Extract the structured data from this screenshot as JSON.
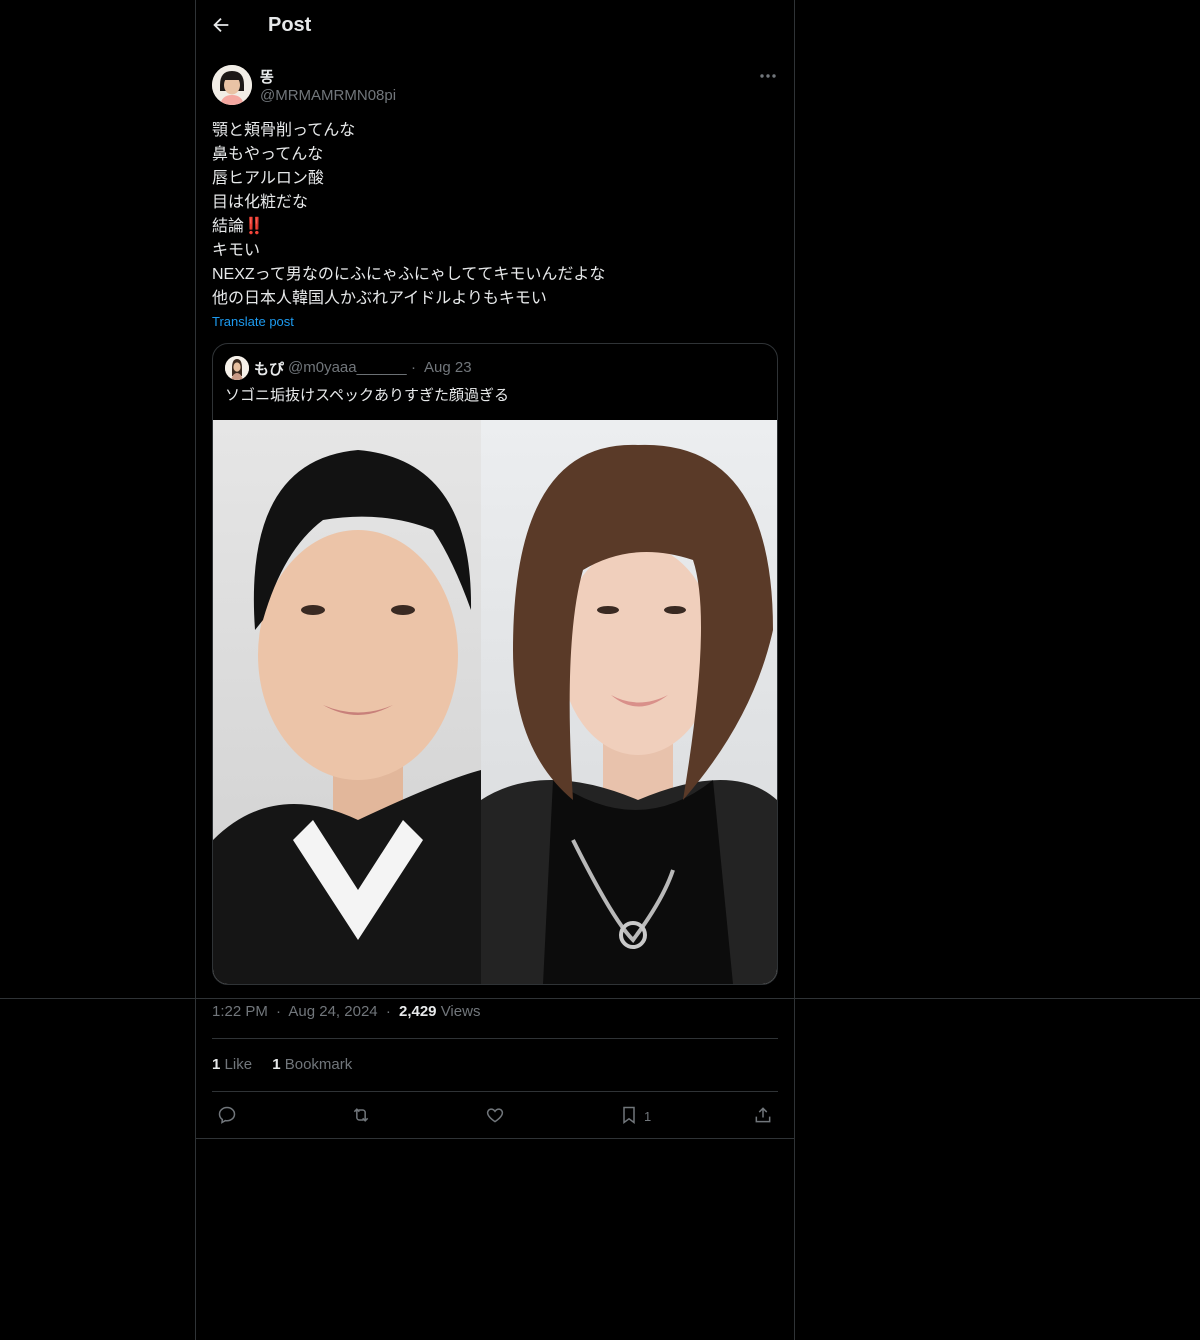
{
  "header": {
    "title": "Post"
  },
  "post": {
    "author_name": "똥",
    "author_handle": "@MRMAMRMN08pi",
    "lines": [
      "顎と頬骨削ってんな",
      "鼻もやってんな",
      "唇ヒアルロン酸",
      "目は化粧だな",
      "結論‼️",
      "キモい",
      "NEXZって男なのにふにゃふにゃしててキモいんだよな",
      "他の日本人韓国人かぶれアイドルよりもキモい"
    ],
    "translate_label": "Translate post",
    "time": "1:22 PM",
    "date": "Aug 24, 2024",
    "views_count": "2,429",
    "views_label": "Views",
    "dot": "·"
  },
  "quote": {
    "author_name": "もぴ",
    "author_handle": "@m0yaaa______",
    "dot": "·",
    "date": "Aug 23",
    "text": "ソゴニ垢抜けスペックありすぎた顔過ぎる"
  },
  "stats": {
    "likes_count": "1",
    "likes_label": "Like",
    "bookmarks_count": "1",
    "bookmarks_label": "Bookmark"
  },
  "actions": {
    "bookmark_count": "1",
    "icons": [
      "reply-icon",
      "retweet-icon",
      "like-icon",
      "bookmark-icon",
      "share-icon"
    ]
  },
  "colors": {
    "background": "#000000",
    "text": "#e7e9ea",
    "muted": "#71767b",
    "link": "#1d9bf0",
    "border": "#2f3336"
  }
}
